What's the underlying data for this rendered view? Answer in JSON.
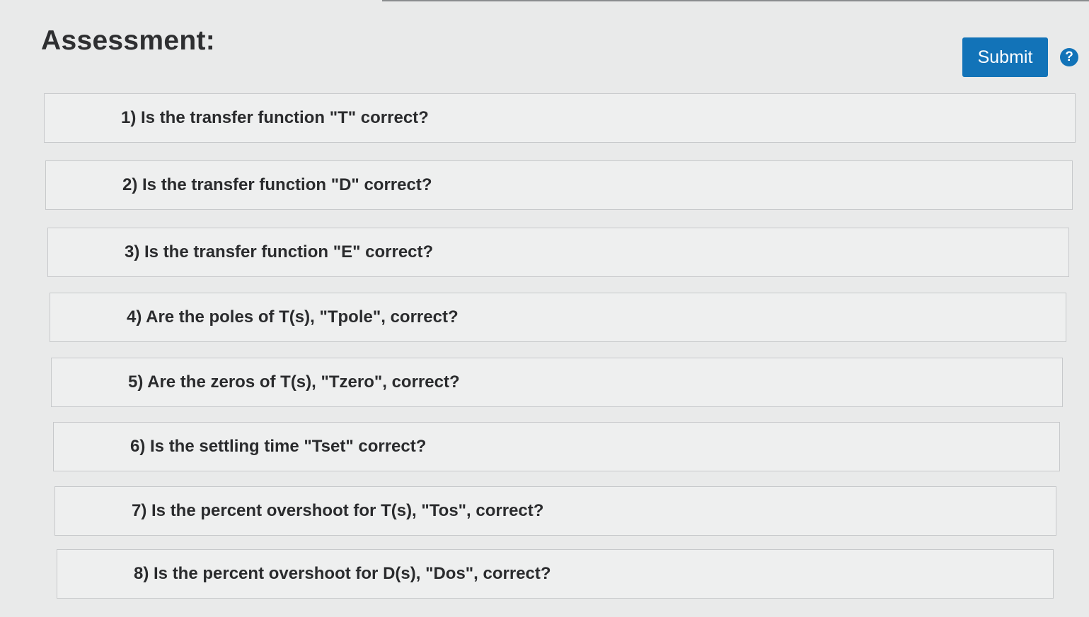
{
  "header": {
    "title": "Assessment:",
    "submit_label": "Submit",
    "help_glyph": "?",
    "help_icon": "question-circle-icon",
    "accent_color": "#1273b8"
  },
  "questions": [
    {
      "label": "1) Is the transfer function \"T\" correct?"
    },
    {
      "label": "2) Is the transfer function \"D\" correct?"
    },
    {
      "label": "3) Is the transfer function \"E\" correct?"
    },
    {
      "label": "4) Are the poles of T(s), \"Tpole\", correct?"
    },
    {
      "label": "5) Are the zeros of T(s), \"Tzero\", correct?"
    },
    {
      "label": "6) Is the settling time \"Tset\" correct?"
    },
    {
      "label": "7) Is the percent overshoot for T(s), \"Tos\", correct?"
    },
    {
      "label": "8) Is the percent overshoot for D(s), \"Dos\", correct?"
    }
  ]
}
